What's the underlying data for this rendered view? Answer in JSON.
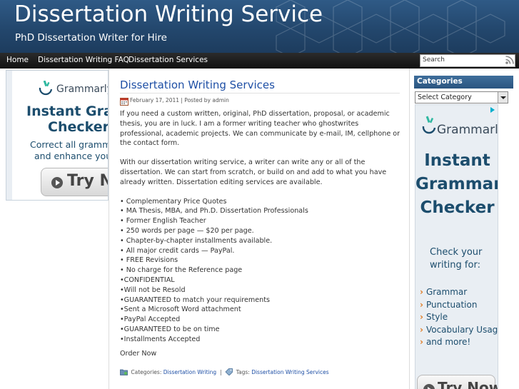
{
  "header": {
    "site_title": "Dissertation Writing Service",
    "tagline": "PhD Dissertation Writer for Hire",
    "colors": {
      "header_bg": "#2a5580",
      "nav_bg": "#1a1a1a",
      "link": "#1e4fa5"
    }
  },
  "nav": {
    "items": [
      {
        "label": "Home"
      },
      {
        "label": "Dissertation Writing FAQ"
      },
      {
        "label": "Dissertation Services"
      }
    ],
    "search_value": "Search",
    "search_icon": "rss-icon"
  },
  "left_ad": {
    "brand": "Grammarly",
    "headline_line1": "Instant Gram",
    "headline_line2": "Checker",
    "sub_line1": "Correct all gramma",
    "sub_line2": "and enhance your",
    "button": "Try Now"
  },
  "post": {
    "title": "Dissertation Writing Services",
    "meta": "February 17, 2011 | Posted by admin",
    "paragraph1": "If you need a  custom written, original, PhD dissertation, proposal, or  academic thesis, you are in luck.  I am a former writing teacher who ghostwrites professional, academic projects.  We can communicate by e-mail, IM, cellphone or the contact form.",
    "paragraph2": "With our dissertation writing service, a writer can write any or all of the dissertation. We can start from scratch, or build on and add to what you have already written. Dissertation editing services are available.",
    "list": [
      "• Complementary Price Quotes",
      "• MA Thesis, MBA, and Ph.D. Dissertation Professionals",
      "• Former English Teacher",
      "•  250 words per page — $20 per page.",
      "•  Chapter-by-chapter installments available.",
      "• All major credit cards — PayPal.",
      "• FREE Revisions",
      "• No charge for the Reference page",
      "•CONFIDENTIAL",
      "•Will not be Resold",
      "•GUARANTEED to match your requirements",
      "•Sent a Microsoft Word attachment",
      "•PayPal Accepted",
      "•GUARANTEED to be on time",
      "•Installments Accepted"
    ],
    "order_now": "Order Now",
    "categories_label": "Categories:",
    "category_link": "Dissertation Writing",
    "tags_label": "Tags:",
    "tag_link": "Dissertation Writing Services"
  },
  "sidebar": {
    "categories_heading": "Categories",
    "select_value": "Select Category"
  },
  "right_ad": {
    "brand": "Grammarly",
    "headline_line1": "Instant",
    "headline_line2": "Grammar",
    "headline_line3": "Checker",
    "check_line1": "Check your",
    "check_line2": "writing for:",
    "features": [
      "Grammar",
      "Punctuation",
      "Style",
      "Vocabulary Usage",
      "and more!"
    ],
    "button": "Try Now"
  }
}
